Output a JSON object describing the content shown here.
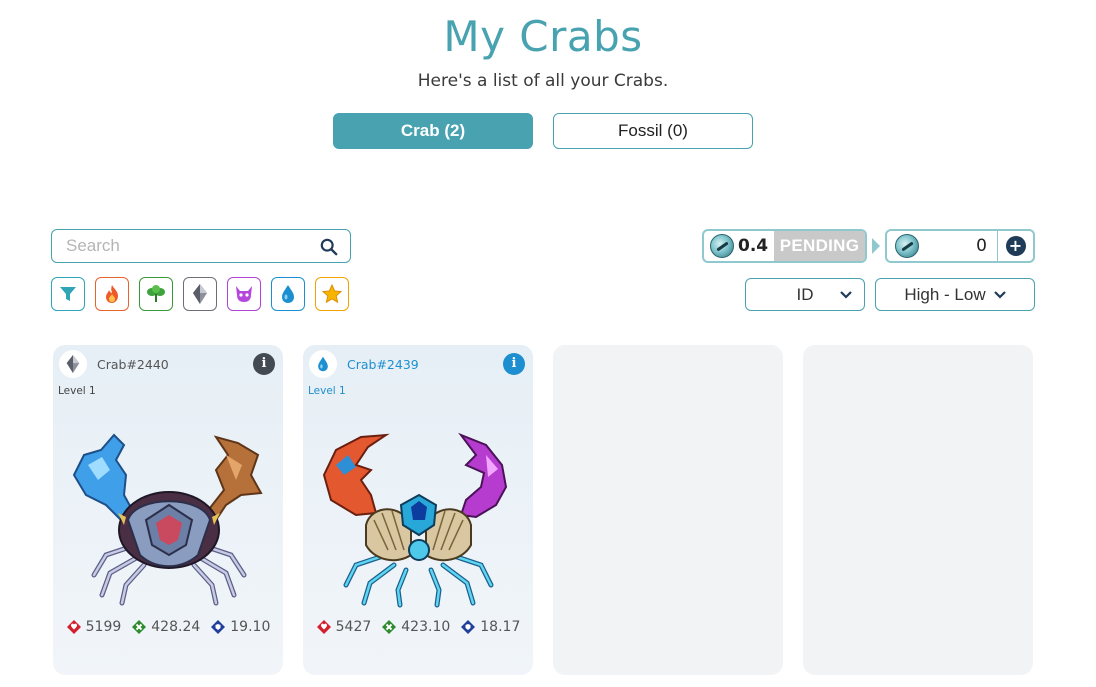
{
  "header": {
    "title": "My Crabs",
    "subtitle": "Here's a list of all your Crabs."
  },
  "tabs": [
    {
      "label": "Crab (2)",
      "active": true
    },
    {
      "label": "Fossil (0)",
      "active": false
    }
  ],
  "search": {
    "placeholder": "Search",
    "value": ""
  },
  "filters": [
    {
      "name": "filter-icon",
      "color": "#2fa5b5"
    },
    {
      "name": "fire-icon",
      "color": "#e8632b"
    },
    {
      "name": "leaf-icon",
      "color": "#3a9a3a"
    },
    {
      "name": "crystal-icon",
      "color": "#6e6e78"
    },
    {
      "name": "demon-icon",
      "color": "#b044d6"
    },
    {
      "name": "water-drop-icon",
      "color": "#1d8fd0"
    },
    {
      "name": "star-icon",
      "color": "#f2a300"
    }
  ],
  "rewards": {
    "pending_amount": "0.4",
    "pending_label": "PENDING",
    "balance": "0",
    "add_label": "+"
  },
  "sort": {
    "field": "ID",
    "order": "High - Low"
  },
  "crabs": [
    {
      "name": "Crab#2440",
      "level": "Level 1",
      "class_icon": "crystal-icon",
      "accent": "#444a52",
      "name_color": "#555555",
      "stats": {
        "hp": "5199",
        "speed": "428.24",
        "defense": "19.10"
      }
    },
    {
      "name": "Crab#2439",
      "level": "Level 1",
      "class_icon": "water-drop-icon",
      "accent": "#1d8fd0",
      "name_color": "#1d8fd0",
      "stats": {
        "hp": "5427",
        "speed": "423.10",
        "defense": "18.17"
      }
    }
  ],
  "colors": {
    "accent": "#48a2b0",
    "hp": "#d21f2b",
    "speed": "#2e8b2e",
    "defense": "#1f3f9a"
  }
}
